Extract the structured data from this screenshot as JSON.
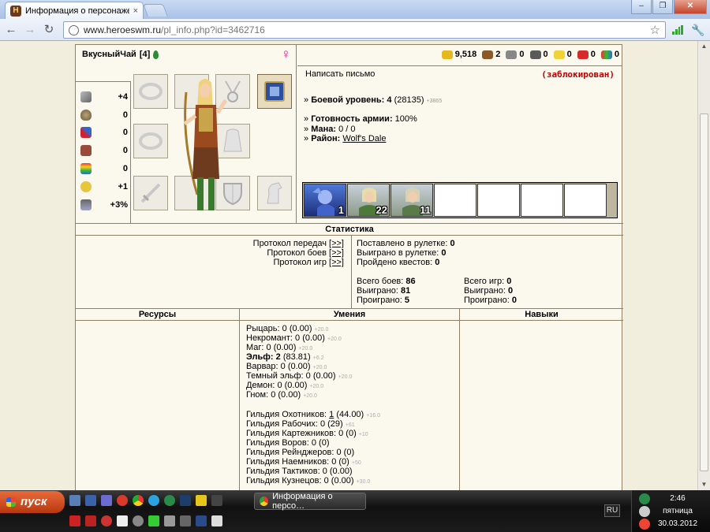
{
  "browser": {
    "tab_title": "Информация о персонаже.",
    "tab_close": "×",
    "url_host": "www.heroeswm.ru",
    "url_path": "/pl_info.php?id=3462716",
    "back": "←",
    "forward": "→",
    "reload": "↻",
    "star": "☆",
    "minimize": "–",
    "maximize": "❐",
    "close": "✕"
  },
  "character": {
    "name": "ВкусныйЧай",
    "level_badge": "[4]",
    "gender_symbol": "♀",
    "stats": [
      "+4",
      "0",
      "0",
      "0",
      "0",
      "+1",
      "+3%"
    ]
  },
  "resources_bar": [
    "9,518",
    "2",
    "0",
    "0",
    "0",
    "0",
    "0"
  ],
  "profile": {
    "write_letter": "Написать письмо",
    "blocked": "(заблокирован)",
    "combat_level_label": "Боевой уровень:",
    "combat_level_value": "4",
    "combat_level_exp": "(28135)",
    "combat_level_next": "+3865",
    "army_ready_label": "Готовность армии:",
    "army_ready_value": "100%",
    "mana_label": "Мана:",
    "mana_value": "0 / 0",
    "district_label": "Район:",
    "district_value": "Wolf's Dale",
    "bullet": "»"
  },
  "army_counts": [
    "1",
    "22",
    "11"
  ],
  "statistics": {
    "header": "Статистика",
    "protocols": [
      {
        "label": "Протокол передач",
        "link": "[>>]"
      },
      {
        "label": "Протокол боев",
        "link": "[>>]"
      },
      {
        "label": "Протокол игр",
        "link": "[>>]"
      }
    ],
    "roulette_bet_label": "Поставлено в рулетке:",
    "roulette_bet": "0",
    "roulette_win_label": "Выиграно в рулетке:",
    "roulette_win": "0",
    "quests_label": "Пройдено квестов:",
    "quests": "0",
    "battles_total_label": "Всего боев:",
    "battles_total": "86",
    "battles_won_label": "Выиграно:",
    "battles_won": "81",
    "battles_lost_label": "Проиграно:",
    "battles_lost": "5",
    "games_total_label": "Всего игр:",
    "games_total": "0",
    "games_won_label": "Выиграно:",
    "games_won": "0",
    "games_lost_label": "Проиграно:",
    "games_lost": "0"
  },
  "sections": {
    "resources": "Ресурсы",
    "skills": "Умения",
    "talents": "Навыки"
  },
  "factions": [
    {
      "name": "Рыцарь:",
      "value": "0 (0.00)",
      "next": "+20.0"
    },
    {
      "name": "Некромант:",
      "value": "0 (0.00)",
      "next": "+20.0"
    },
    {
      "name": "Маг:",
      "value": "0 (0.00)",
      "next": "+20.0"
    },
    {
      "name": "Эльф:",
      "value": "2",
      "extra": "(83.81)",
      "next": "+6.2"
    },
    {
      "name": "Варвар:",
      "value": "0 (0.00)",
      "next": "+20.0"
    },
    {
      "name": "Темный эльф:",
      "value": "0 (0.00)",
      "next": "+20.0"
    },
    {
      "name": "Демон:",
      "value": "0 (0.00)",
      "next": "+20.0"
    },
    {
      "name": "Гном:",
      "value": "0 (0.00)",
      "next": "+20.0"
    }
  ],
  "guilds": [
    {
      "name": "Гильдия Охотников:",
      "value": "1",
      "extra": "(44.00)",
      "next": "+16.0"
    },
    {
      "name": "Гильдия Рабочих:",
      "value": "0 (29)",
      "next": "+61"
    },
    {
      "name": "Гильдия Картежников:",
      "value": "0 (0)",
      "next": "+10"
    },
    {
      "name": "Гильдия Воров:",
      "value": "0 (0)",
      "next": ""
    },
    {
      "name": "Гильдия Рейнджеров:",
      "value": "0 (0)",
      "next": ""
    },
    {
      "name": "Гильдия Наемников:",
      "value": "0 (0)",
      "next": "+50"
    },
    {
      "name": "Гильдия Тактиков:",
      "value": "0 (0.00)",
      "next": ""
    },
    {
      "name": "Гильдия Кузнецов:",
      "value": "0 (0.00)",
      "next": "+30.0"
    }
  ],
  "taskbar": {
    "start": "пуск",
    "window_title": "Информация о персо…",
    "lang": "RU",
    "time": "2:46",
    "weekday": "пятница",
    "date": "30.03.2012"
  }
}
